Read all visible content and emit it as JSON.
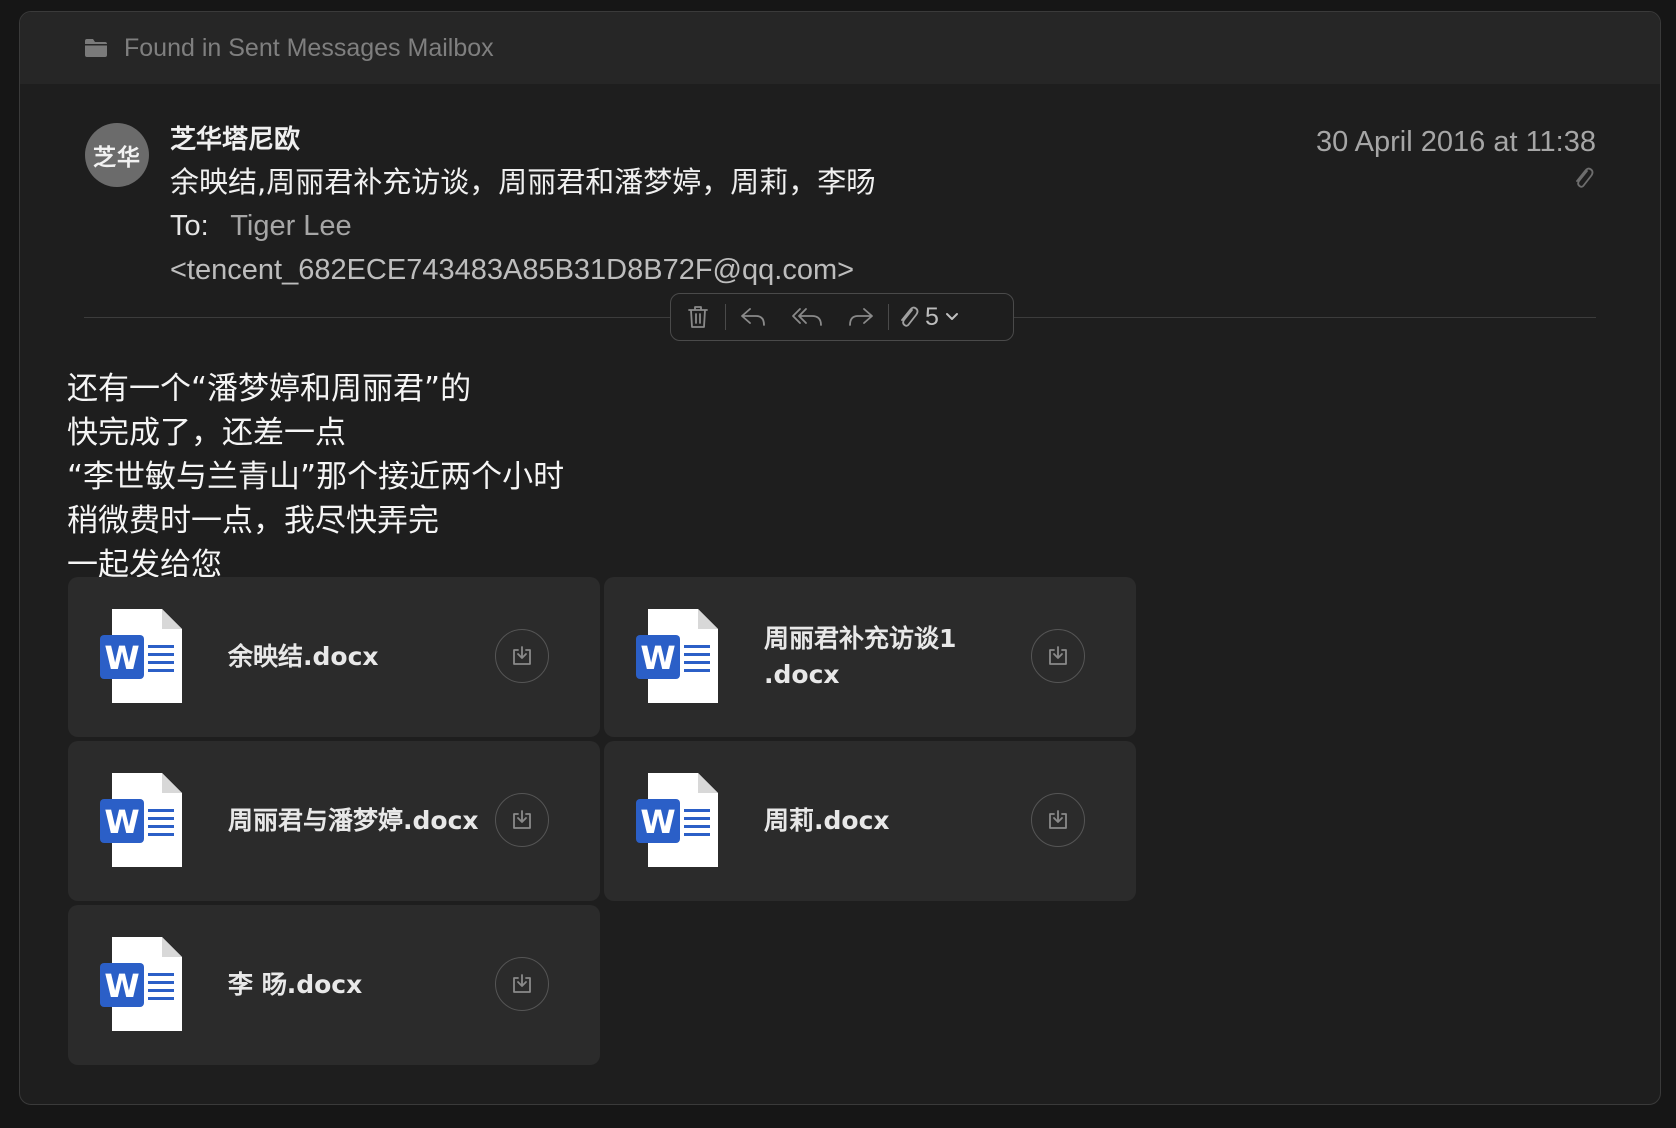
{
  "mailbox_bar": {
    "text": "Found in Sent Messages Mailbox",
    "icon": "folder-icon"
  },
  "message": {
    "avatar_initials": "芝华",
    "sender": "芝华塔尼欧",
    "subject": "余映结,周丽君补充访谈，周丽君和潘梦婷，周莉，李旸",
    "to_label": "To:",
    "to_name": "Tiger Lee",
    "to_email": "<tencent_682ECE743483A85B31D8B72F@qq.com>",
    "date": "30 April 2016 at 11:38"
  },
  "toolbar": {
    "attachment_count": "5",
    "icons": [
      "trash-icon",
      "reply-icon",
      "reply-all-icon",
      "forward-icon",
      "paperclip-icon",
      "chevron-down-icon"
    ]
  },
  "body_lines": [
    "还有一个“潘梦婷和周丽君”的",
    "快完成了，还差一点",
    "“李世敏与兰青山”那个接近两个小时",
    "稍微费时一点，我尽快弄完",
    "一起发给您"
  ],
  "attachments": [
    {
      "name": "余映结.docx"
    },
    {
      "name": "周丽君补充访谈1\n.docx"
    },
    {
      "name": "周丽君与潘梦婷.docx"
    },
    {
      "name": "周莉.docx"
    },
    {
      "name": "李 旸.docx"
    }
  ],
  "colors": {
    "word_blue": "#2b5fc7",
    "background": "#1e1e1e",
    "card": "#2b2b2b"
  }
}
